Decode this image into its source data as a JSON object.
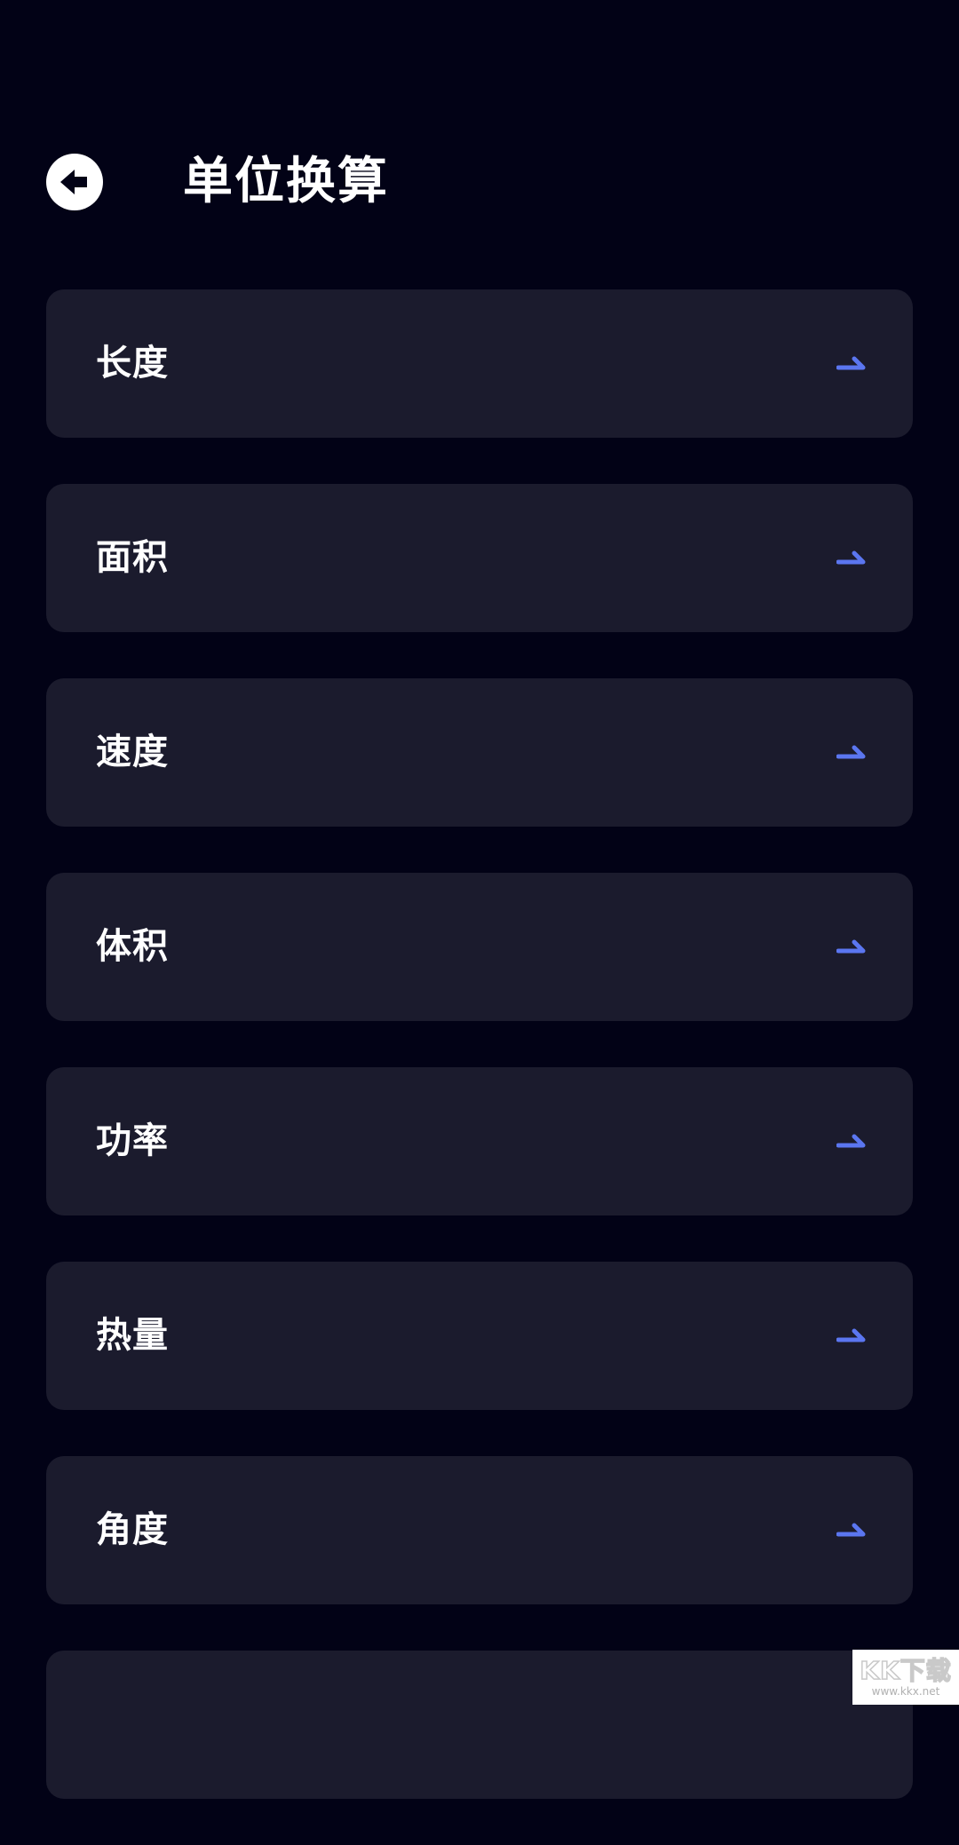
{
  "header": {
    "title": "单位换算",
    "back_icon": "arrow-left-circle-icon"
  },
  "items": [
    {
      "label": "长度",
      "icon": "arrow-right-icon"
    },
    {
      "label": "面积",
      "icon": "arrow-right-icon"
    },
    {
      "label": "速度",
      "icon": "arrow-right-icon"
    },
    {
      "label": "体积",
      "icon": "arrow-right-icon"
    },
    {
      "label": "功率",
      "icon": "arrow-right-icon"
    },
    {
      "label": "热量",
      "icon": "arrow-right-icon"
    },
    {
      "label": "角度",
      "icon": "arrow-right-icon"
    },
    {
      "label": "",
      "icon": ""
    }
  ],
  "watermark": {
    "logo": "KK下载",
    "url": "www.kkx.net"
  },
  "colors": {
    "background": "#020216",
    "card": "#1b1b2d",
    "accent": "#5b76f0",
    "text": "#ffffff"
  }
}
